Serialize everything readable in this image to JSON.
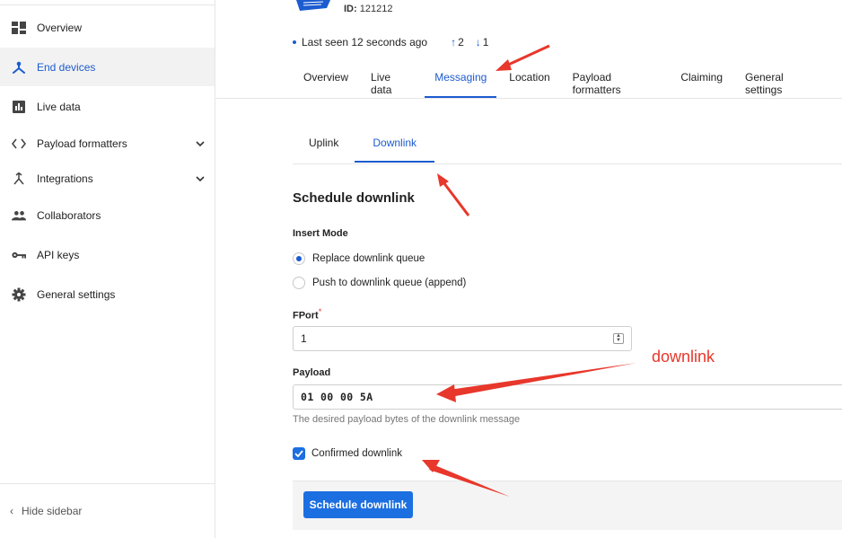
{
  "sidebar": {
    "items": [
      {
        "label": "Overview",
        "icon": "overview-icon"
      },
      {
        "label": "End devices",
        "icon": "end-devices-icon",
        "active": true
      },
      {
        "label": "Live data",
        "icon": "live-data-icon"
      },
      {
        "label": "Payload formatters",
        "icon": "code-icon",
        "expandable": true
      },
      {
        "label": "Integrations",
        "icon": "integrations-icon",
        "expandable": true
      },
      {
        "label": "Collaborators",
        "icon": "collaborators-icon"
      },
      {
        "label": "API keys",
        "icon": "key-icon"
      },
      {
        "label": "General settings",
        "icon": "gear-icon"
      }
    ],
    "hide_label": "Hide sidebar"
  },
  "device": {
    "id_label": "ID:",
    "id_value": "121212",
    "last_seen": "Last seen 12 seconds ago",
    "uplink_count": "2",
    "downlink_count": "1"
  },
  "tabs": [
    "Overview",
    "Live data",
    "Messaging",
    "Location",
    "Payload formatters",
    "Claiming",
    "General settings"
  ],
  "active_tab": "Messaging",
  "subtabs": {
    "uplink": "Uplink",
    "downlink": "Downlink",
    "active": "Downlink"
  },
  "form": {
    "title": "Schedule downlink",
    "insert_mode_label": "Insert Mode",
    "insert_mode_options": [
      "Replace downlink queue",
      "Push to downlink queue (append)"
    ],
    "insert_mode_selected": "Replace downlink queue",
    "fport_label": "FPort",
    "fport_required_mark": "*",
    "fport_value": "1",
    "payload_label": "Payload",
    "payload_value": "01 00 00 5A",
    "payload_hint": "The desired payload bytes of the downlink message",
    "confirmed_label": "Confirmed downlink",
    "confirmed_checked": true,
    "submit_label": "Schedule downlink"
  },
  "annotation_text": "downlink",
  "colors": {
    "accent": "#1c5bd0",
    "button": "#1c6fe0",
    "annotation": "#e8372b"
  }
}
